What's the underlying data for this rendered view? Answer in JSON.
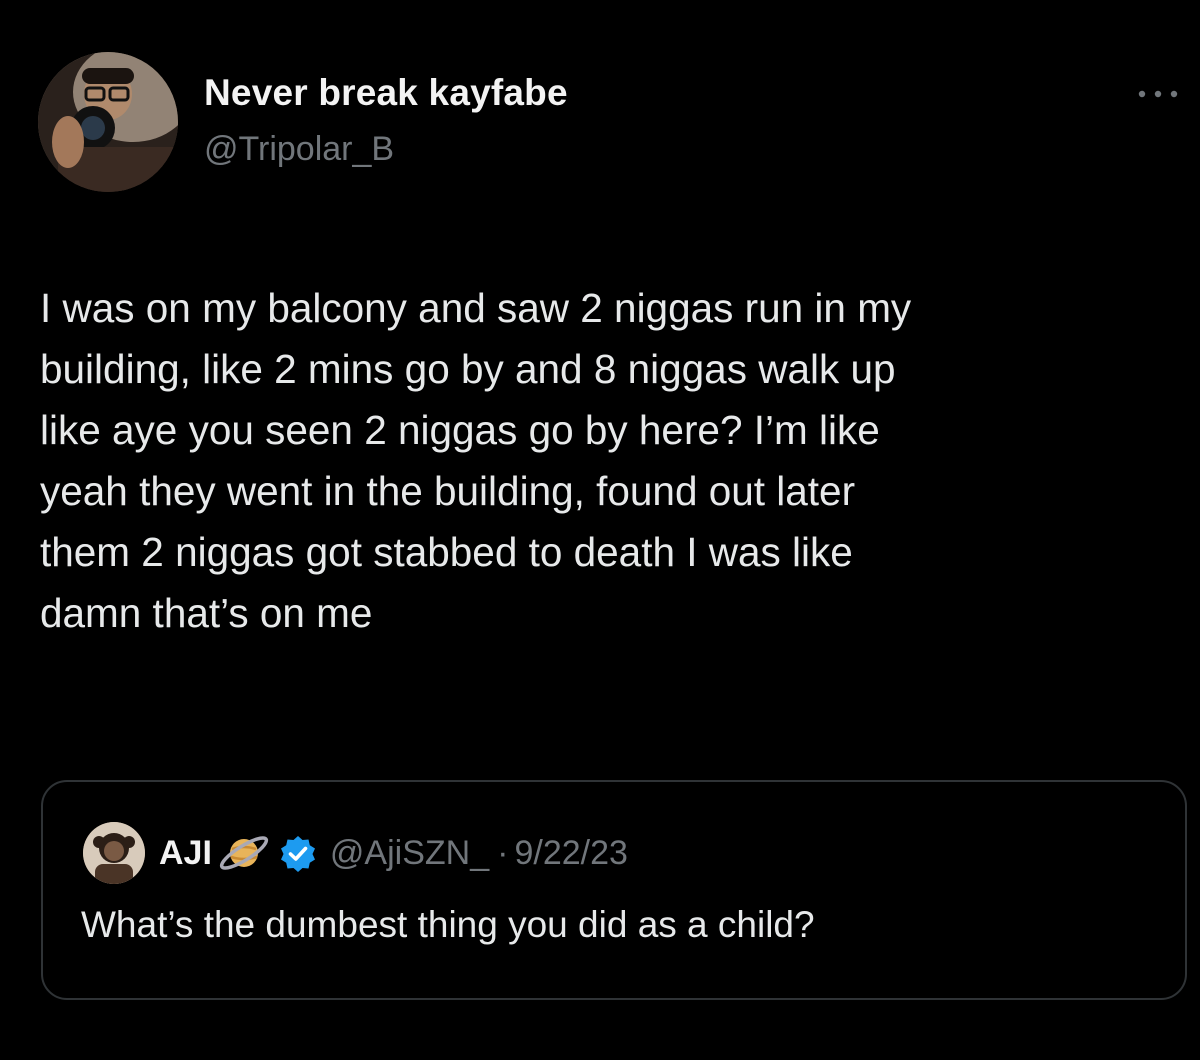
{
  "tweet": {
    "author": {
      "display_name": "Never break kayfabe",
      "handle": "@Tripolar_B",
      "avatar_icon": "profile-photo"
    },
    "more_icon": "ellipsis-icon",
    "text": "I was on my balcony and saw 2 niggas run in my\nbuilding, like 2 mins go by and 8 niggas walk up\nlike aye you seen 2 niggas go by here? I’m like\nyeah they went in the building, found out later\nthem 2 niggas got stabbed to death I was like\ndamn that’s on me"
  },
  "quote": {
    "display_name": "AJI",
    "name_emoji": "ringed-planet-icon",
    "verified_icon": "verified-badge-icon",
    "handle": "@AjiSZN_",
    "separator": "·",
    "date": "9/22/23",
    "text": "What’s the dumbest thing you did as a child?"
  },
  "colors": {
    "background": "#000000",
    "primary_text": "#e7e9ea",
    "secondary_text": "#71767b",
    "border": "#2f3336",
    "verified_blue": "#1d9bf0"
  }
}
